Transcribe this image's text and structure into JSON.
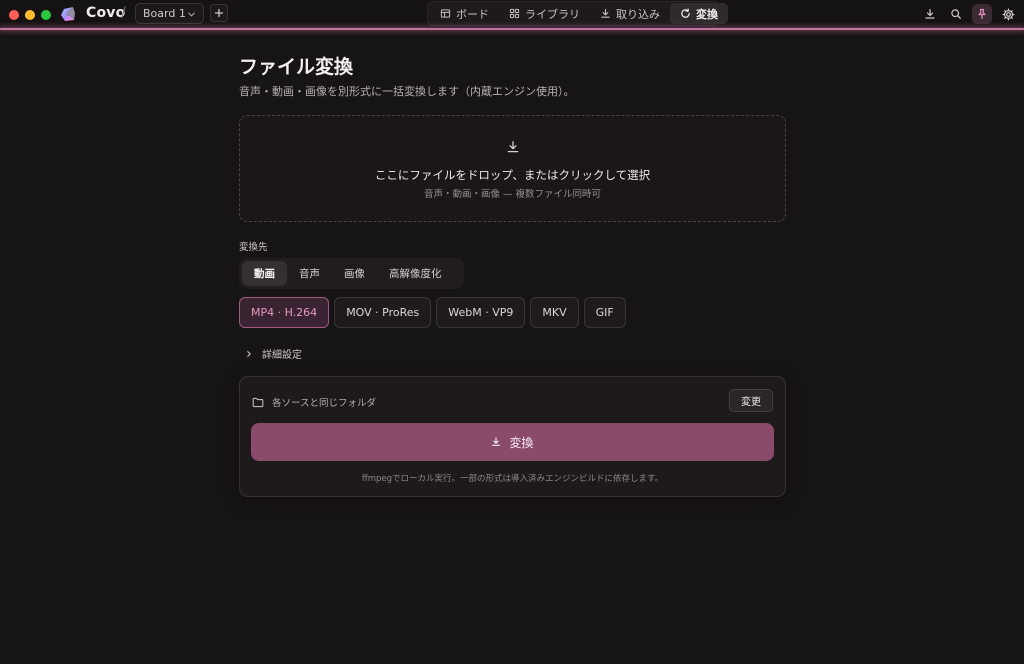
{
  "window": {
    "traffic_colors": [
      "#ff5f57",
      "#febc2e",
      "#28c840"
    ],
    "app_name": "Covo",
    "breadcrumb_separator": "/",
    "board_selector": {
      "value": "Board 1"
    },
    "add_board_icon": "plus-icon"
  },
  "nav": {
    "tabs": [
      {
        "label": "ボード",
        "icon": "board-icon",
        "active": false
      },
      {
        "label": "ライブラリ",
        "icon": "grid-icon",
        "active": false
      },
      {
        "label": "取り込み",
        "icon": "import-icon",
        "active": false
      },
      {
        "label": "変換",
        "icon": "refresh-icon",
        "active": true
      }
    ]
  },
  "toolbar_right": [
    "download-icon",
    "search-icon",
    "pin-icon",
    "gear-icon"
  ],
  "page": {
    "title": "ファイル変換",
    "subtitle": "音声・動画・画像を別形式に一括変換します（内蔵エンジン使用）。"
  },
  "dropzone": {
    "icon": "download-icon",
    "title": "ここにファイルをドロップ、またはクリックして選択",
    "hint": "音声・動画・画像 — 複数ファイル同時可"
  },
  "target": {
    "label": "変換先",
    "categories": [
      {
        "label": "動画",
        "active": true
      },
      {
        "label": "音声",
        "active": false
      },
      {
        "label": "画像",
        "active": false
      },
      {
        "label": "高解像度化",
        "active": false
      }
    ],
    "formats": [
      {
        "label": "MP4 · H.264",
        "active": true
      },
      {
        "label": "MOV · ProRes",
        "active": false
      },
      {
        "label": "WebM · VP9",
        "active": false
      },
      {
        "label": "MKV",
        "active": false
      },
      {
        "label": "GIF",
        "active": false
      }
    ]
  },
  "advanced": {
    "label": "詳細設定",
    "icon": "chevron-right-icon"
  },
  "output": {
    "folder_icon": "folder-icon",
    "folder_label": "各ソースと同じフォルダ",
    "change_label": "変更",
    "convert_label": "変換",
    "footnote": "ffmpegでローカル実行。一部の形式は導入済みエンジンビルドに依存します。"
  },
  "colors": {
    "accent": "#c2739d",
    "convert_button": "#8a4b6b",
    "format_active_text": "#e49ac3",
    "background": "#171415"
  }
}
